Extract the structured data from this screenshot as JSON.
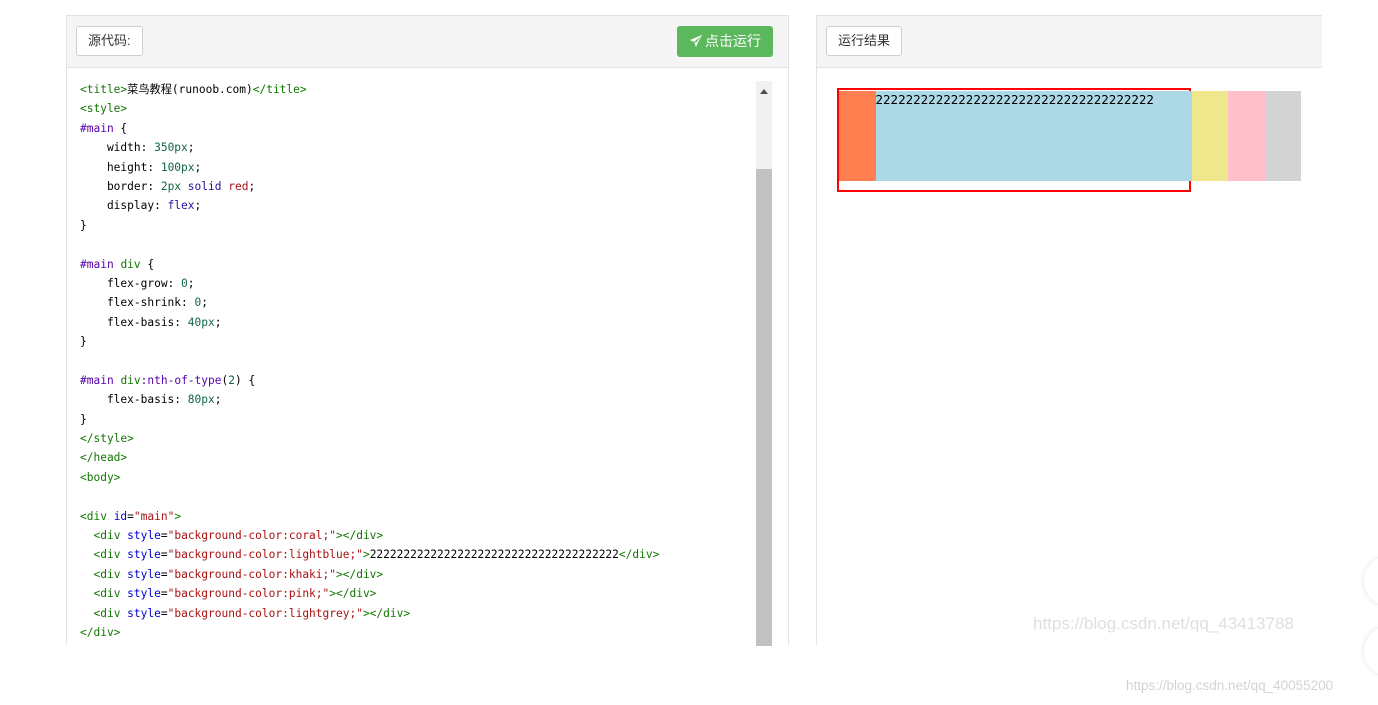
{
  "source_panel": {
    "label": "源代码:",
    "run_button": "点击运行",
    "code_lines": [
      [
        {
          "t": "<title>",
          "c": "tag"
        },
        {
          "t": "菜鸟教程(runoob.com)",
          "c": "plain"
        },
        {
          "t": "</title>",
          "c": "tag"
        }
      ],
      [
        {
          "t": "<style>",
          "c": "tag"
        }
      ],
      [
        {
          "t": "#main",
          "c": "sel"
        },
        {
          "t": " {",
          "c": "plain"
        }
      ],
      [
        {
          "t": "    width: ",
          "c": "plain"
        },
        {
          "t": "350px",
          "c": "num"
        },
        {
          "t": ";",
          "c": "plain"
        }
      ],
      [
        {
          "t": "    height: ",
          "c": "plain"
        },
        {
          "t": "100px",
          "c": "num"
        },
        {
          "t": ";",
          "c": "plain"
        }
      ],
      [
        {
          "t": "    border: ",
          "c": "plain"
        },
        {
          "t": "2px",
          "c": "num"
        },
        {
          "t": " ",
          "c": "plain"
        },
        {
          "t": "solid",
          "c": "atom"
        },
        {
          "t": " ",
          "c": "plain"
        },
        {
          "t": "red",
          "c": "kw"
        },
        {
          "t": ";",
          "c": "plain"
        }
      ],
      [
        {
          "t": "    display: ",
          "c": "plain"
        },
        {
          "t": "flex",
          "c": "atom"
        },
        {
          "t": ";",
          "c": "plain"
        }
      ],
      [
        {
          "t": "}",
          "c": "plain"
        }
      ],
      [
        {
          "t": "",
          "c": "plain"
        }
      ],
      [
        {
          "t": "#main",
          "c": "sel"
        },
        {
          "t": " ",
          "c": "plain"
        },
        {
          "t": "div",
          "c": "tag"
        },
        {
          "t": " {",
          "c": "plain"
        }
      ],
      [
        {
          "t": "    flex-grow: ",
          "c": "plain"
        },
        {
          "t": "0",
          "c": "num"
        },
        {
          "t": ";",
          "c": "plain"
        }
      ],
      [
        {
          "t": "    flex-shrink: ",
          "c": "plain"
        },
        {
          "t": "0",
          "c": "num"
        },
        {
          "t": ";",
          "c": "plain"
        }
      ],
      [
        {
          "t": "    flex-basis: ",
          "c": "plain"
        },
        {
          "t": "40px",
          "c": "num"
        },
        {
          "t": ";",
          "c": "plain"
        }
      ],
      [
        {
          "t": "}",
          "c": "plain"
        }
      ],
      [
        {
          "t": "",
          "c": "plain"
        }
      ],
      [
        {
          "t": "#main",
          "c": "sel"
        },
        {
          "t": " ",
          "c": "plain"
        },
        {
          "t": "div",
          "c": "tag"
        },
        {
          "t": ":nth-of-type",
          "c": "sel"
        },
        {
          "t": "(",
          "c": "plain"
        },
        {
          "t": "2",
          "c": "num"
        },
        {
          "t": ") {",
          "c": "plain"
        }
      ],
      [
        {
          "t": "    flex-basis: ",
          "c": "plain"
        },
        {
          "t": "80px",
          "c": "num"
        },
        {
          "t": ";",
          "c": "plain"
        }
      ],
      [
        {
          "t": "}",
          "c": "plain"
        }
      ],
      [
        {
          "t": "</style>",
          "c": "tag"
        }
      ],
      [
        {
          "t": "</head>",
          "c": "tag"
        }
      ],
      [
        {
          "t": "<body>",
          "c": "tag"
        }
      ],
      [
        {
          "t": "",
          "c": "plain"
        }
      ],
      [
        {
          "t": "<div ",
          "c": "tag"
        },
        {
          "t": "id",
          "c": "attr"
        },
        {
          "t": "=",
          "c": "plain"
        },
        {
          "t": "\"main\"",
          "c": "str"
        },
        {
          "t": ">",
          "c": "tag"
        }
      ],
      [
        {
          "t": "  ",
          "c": "plain"
        },
        {
          "t": "<div ",
          "c": "tag"
        },
        {
          "t": "style",
          "c": "attr"
        },
        {
          "t": "=",
          "c": "plain"
        },
        {
          "t": "\"background-color:coral;\"",
          "c": "str"
        },
        {
          "t": "></div>",
          "c": "tag"
        }
      ],
      [
        {
          "t": "  ",
          "c": "plain"
        },
        {
          "t": "<div ",
          "c": "tag"
        },
        {
          "t": "style",
          "c": "attr"
        },
        {
          "t": "=",
          "c": "plain"
        },
        {
          "t": "\"background-color:lightblue;\"",
          "c": "str"
        },
        {
          "t": ">",
          "c": "tag"
        },
        {
          "t": "2222222222222222222222222222222222222",
          "c": "plain"
        },
        {
          "t": "</div>",
          "c": "tag"
        }
      ],
      [
        {
          "t": "  ",
          "c": "plain"
        },
        {
          "t": "<div ",
          "c": "tag"
        },
        {
          "t": "style",
          "c": "attr"
        },
        {
          "t": "=",
          "c": "plain"
        },
        {
          "t": "\"background-color:khaki;\"",
          "c": "str"
        },
        {
          "t": "></div>",
          "c": "tag"
        }
      ],
      [
        {
          "t": "  ",
          "c": "plain"
        },
        {
          "t": "<div ",
          "c": "tag"
        },
        {
          "t": "style",
          "c": "attr"
        },
        {
          "t": "=",
          "c": "plain"
        },
        {
          "t": "\"background-color:pink;\"",
          "c": "str"
        },
        {
          "t": "></div>",
          "c": "tag"
        }
      ],
      [
        {
          "t": "  ",
          "c": "plain"
        },
        {
          "t": "<div ",
          "c": "tag"
        },
        {
          "t": "style",
          "c": "attr"
        },
        {
          "t": "=",
          "c": "plain"
        },
        {
          "t": "\"background-color:lightgrey;\"",
          "c": "str"
        },
        {
          "t": "></div>",
          "c": "tag"
        }
      ],
      [
        {
          "t": "</div>",
          "c": "tag"
        }
      ]
    ]
  },
  "result_panel": {
    "label": "运行结果",
    "blocks": [
      {
        "color": "#ff7f50",
        "text": ""
      },
      {
        "color": "#add8e6",
        "text": "2222222222222222222222222222222222222"
      },
      {
        "color": "#f0e68c",
        "text": ""
      },
      {
        "color": "#ffc0cb",
        "text": ""
      },
      {
        "color": "#d3d3d3",
        "text": ""
      }
    ]
  },
  "watermarks": {
    "inner": "https://blog.csdn.net/qq_43413788",
    "outer": "https://blog.csdn.net/qq_40055200"
  },
  "icons": {
    "run": "paper-plane-icon"
  }
}
